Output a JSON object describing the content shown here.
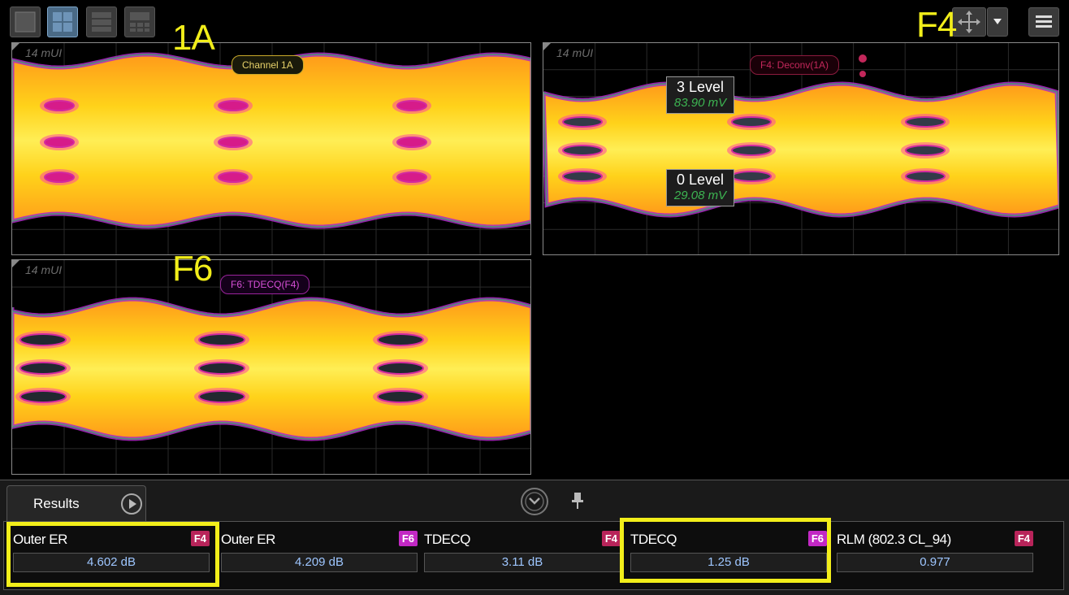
{
  "toolbar": {
    "layout_buttons": [
      "single-layout",
      "quad-layout",
      "stacked-layout",
      "grid-layout"
    ],
    "active_layout": 1,
    "icons": [
      "move-icon",
      "dropdown-arrow-icon",
      "menu-icon"
    ]
  },
  "annotations": {
    "label_1a": "1A",
    "label_f4": "F4",
    "label_f6": "F6"
  },
  "panels": {
    "p1": {
      "scale": "14 mUI",
      "tag": "Channel 1A"
    },
    "p2": {
      "scale": "14 mUI",
      "tag": "F4: Deconv(1A)",
      "level3": {
        "title": "3 Level",
        "value": "83.90 mV"
      },
      "level0": {
        "title": "0 Level",
        "value": "29.08 mV"
      }
    },
    "p3": {
      "scale": "14 mUI",
      "tag": "F6: TDECQ(F4)"
    }
  },
  "results": {
    "tab_label": "Results",
    "measurements": [
      {
        "name": "Outer ER",
        "source": "F4",
        "value": "4.602 dB",
        "src_color": "#b8245a"
      },
      {
        "name": "Outer ER",
        "source": "F6",
        "value": "4.209 dB",
        "src_color": "#c228c4"
      },
      {
        "name": "TDECQ",
        "source": "F4",
        "value": "3.11 dB",
        "src_color": "#b8245a"
      },
      {
        "name": "TDECQ",
        "source": "F6",
        "value": "1.25 dB",
        "src_color": "#c228c4"
      },
      {
        "name": "RLM (802.3 CL_94)",
        "source": "F4",
        "value": "0.977",
        "src_color": "#b8245a"
      }
    ]
  },
  "colors": {
    "annotation_yellow": "#f2ee1a",
    "value_blue": "#9ec6ff",
    "level_green": "#3db552"
  }
}
